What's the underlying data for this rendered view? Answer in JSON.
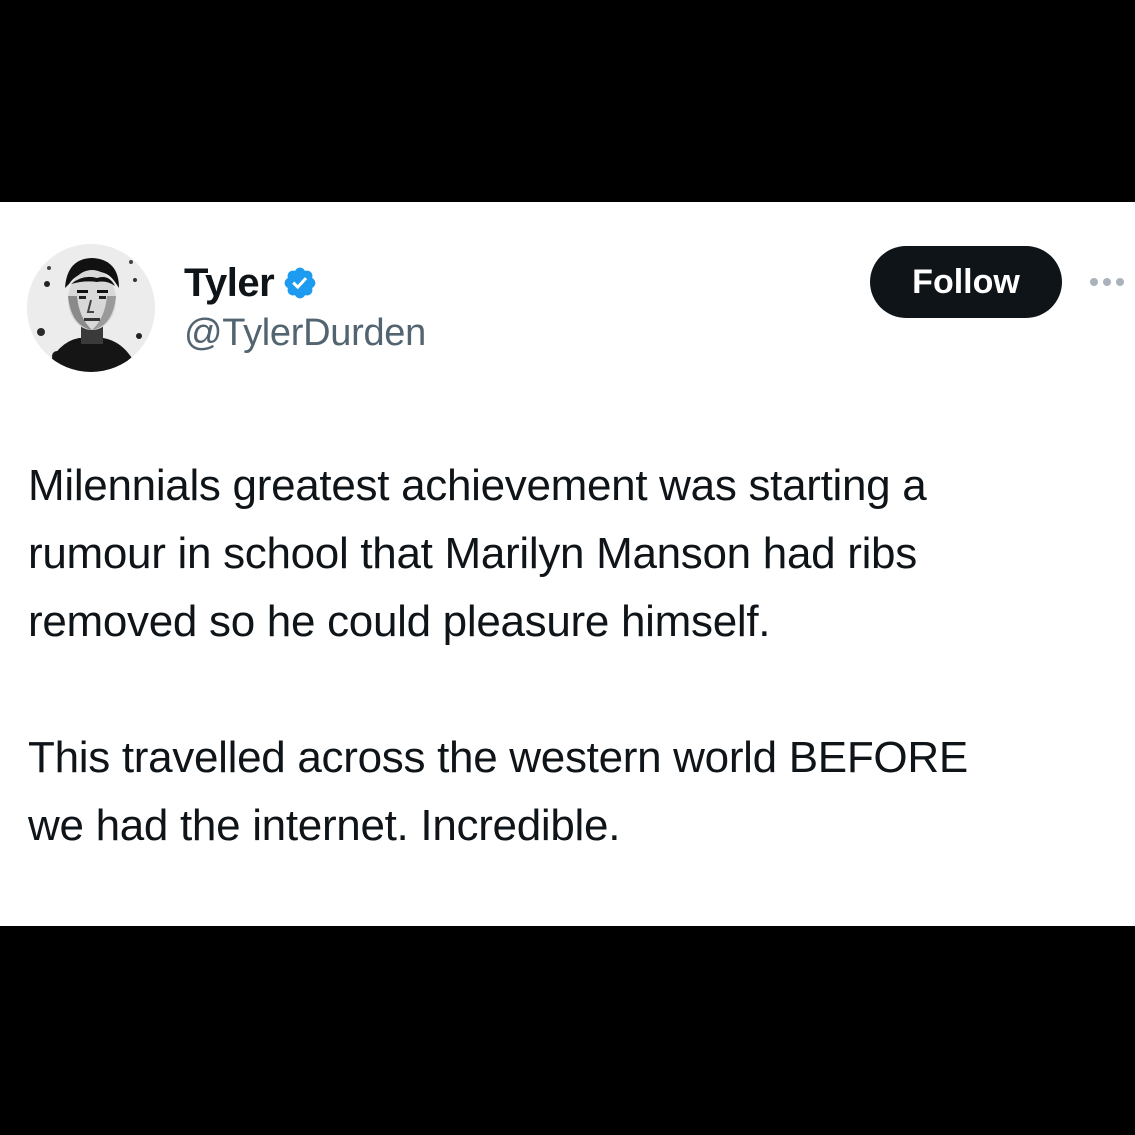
{
  "tweet": {
    "author": {
      "display_name": "Tyler",
      "handle": "@TylerDurden",
      "verified": true,
      "avatar_icon": "portrait-avatar"
    },
    "follow_label": "Follow",
    "more_icon": "ellipsis-icon",
    "paragraphs": [
      "Milennials greatest achievement was starting a\nrumour in school that Marilyn Manson had ribs\nremoved so he could pleasure himself.",
      "This travelled across the western world BEFORE\nwe had the internet. Incredible."
    ]
  },
  "colors": {
    "background": "#000000",
    "card": "#ffffff",
    "text_primary": "#0f1419",
    "text_secondary": "#536471",
    "verified_blue": "#1d9bf0",
    "button_bg": "#0f1419",
    "button_text": "#ffffff"
  }
}
